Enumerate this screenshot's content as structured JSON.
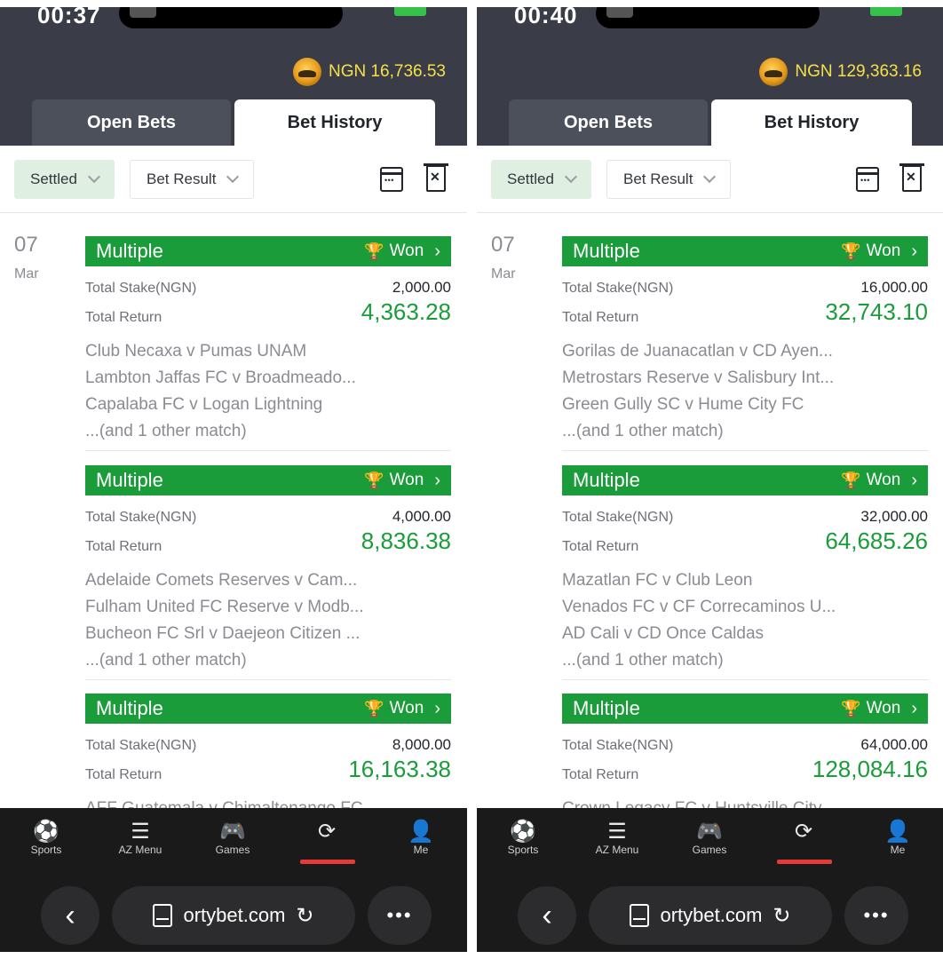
{
  "screens": [
    {
      "status_time": "00:37",
      "balance": "NGN 16,736.53",
      "tabs": {
        "open": "Open Bets",
        "history": "Bet History"
      },
      "filters": {
        "settled": "Settled",
        "result": "Bet Result"
      },
      "date": {
        "day": "07",
        "month": "Mar"
      },
      "bets": [
        {
          "type": "Multiple",
          "status": "Won",
          "stake_label": "Total Stake(NGN)",
          "stake": "2,000.00",
          "return_label": "Total Return",
          "return": "4,363.28",
          "matches": [
            "Club Necaxa v Pumas UNAM",
            "Lambton Jaffas FC v Broadmeado...",
            "Capalaba FC v Logan Lightning",
            "...(and 1 other match)"
          ]
        },
        {
          "type": "Multiple",
          "status": "Won",
          "stake_label": "Total Stake(NGN)",
          "stake": "4,000.00",
          "return_label": "Total Return",
          "return": "8,836.38",
          "matches": [
            "Adelaide Comets Reserves v Cam...",
            "Fulham United FC Reserve v Modb...",
            "Bucheon FC Srl v Daejeon Citizen ...",
            "...(and 1 other match)"
          ]
        },
        {
          "type": "Multiple",
          "status": "Won",
          "stake_label": "Total Stake(NGN)",
          "stake": "8,000.00",
          "return_label": "Total Return",
          "return": "16,163.38",
          "matches": [
            "AFF Guatemala v Chimaltenango FC"
          ]
        }
      ],
      "nav": {
        "sports": "Sports",
        "az": "AZ Menu",
        "games": "Games",
        "me": "Me"
      },
      "url": "ortybet.com"
    },
    {
      "status_time": "00:40",
      "balance": "NGN 129,363.16",
      "tabs": {
        "open": "Open Bets",
        "history": "Bet History"
      },
      "filters": {
        "settled": "Settled",
        "result": "Bet Result"
      },
      "date": {
        "day": "07",
        "month": "Mar"
      },
      "bets": [
        {
          "type": "Multiple",
          "status": "Won",
          "stake_label": "Total Stake(NGN)",
          "stake": "16,000.00",
          "return_label": "Total Return",
          "return": "32,743.10",
          "matches": [
            "Gorilas de Juanacatlan v CD Ayen...",
            "Metrostars Reserve v Salisbury Int...",
            "Green Gully SC v Hume City FC",
            "...(and 1 other match)"
          ]
        },
        {
          "type": "Multiple",
          "status": "Won",
          "stake_label": "Total Stake(NGN)",
          "stake": "32,000.00",
          "return_label": "Total Return",
          "return": "64,685.26",
          "matches": [
            "Mazatlan FC v Club Leon",
            "Venados FC v CF Correcaminos U...",
            "AD Cali v CD Once Caldas",
            "...(and 1 other match)"
          ]
        },
        {
          "type": "Multiple",
          "status": "Won",
          "stake_label": "Total Stake(NGN)",
          "stake": "64,000.00",
          "return_label": "Total Return",
          "return": "128,084.16",
          "matches": [
            "Crown Legacy FC v Huntsville City ..."
          ]
        }
      ],
      "nav": {
        "sports": "Sports",
        "az": "AZ Menu",
        "games": "Games",
        "me": "Me"
      },
      "url": "ortybet.com"
    }
  ],
  "colors": {
    "header": "#3a3d47",
    "accent_green": "#1b9c3a",
    "balance_yellow": "#f5e04a",
    "nav_active": "#e53a3a"
  }
}
